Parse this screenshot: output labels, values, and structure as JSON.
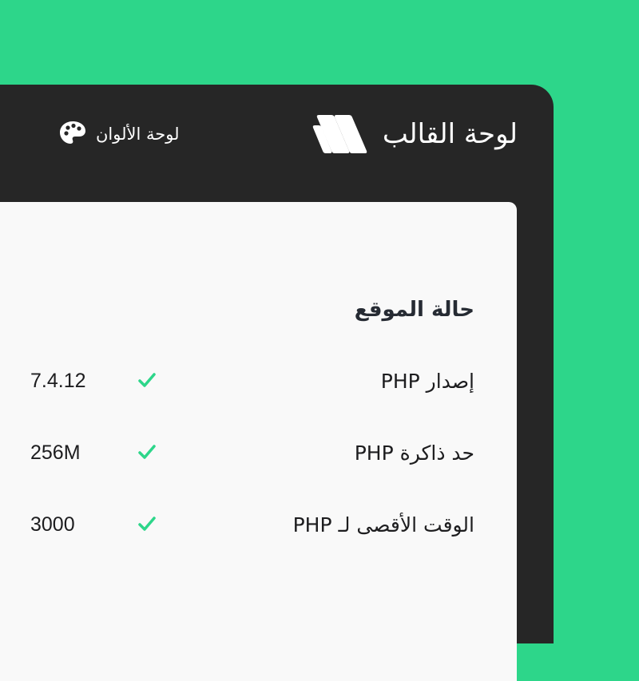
{
  "header": {
    "title": "لوحة القالب",
    "logo_icon": "brand-stripes-logo",
    "colors_link": {
      "label": "لوحة الألوان",
      "icon": "palette-icon"
    }
  },
  "status": {
    "title": "حالة الموقع",
    "rows": [
      {
        "label": "إصدار PHP",
        "status_icon": "check-icon",
        "value": "7.4.12"
      },
      {
        "label": "حد ذاكرة PHP",
        "status_icon": "check-icon",
        "value": "256M"
      },
      {
        "label": "الوقت الأقصى لـ PHP",
        "status_icon": "check-icon",
        "value": "3000"
      }
    ]
  },
  "colors": {
    "page_background": "#2dd68a",
    "panel_background": "#262626",
    "content_background": "#f9f9f9",
    "check_color": "#2dd68a"
  }
}
